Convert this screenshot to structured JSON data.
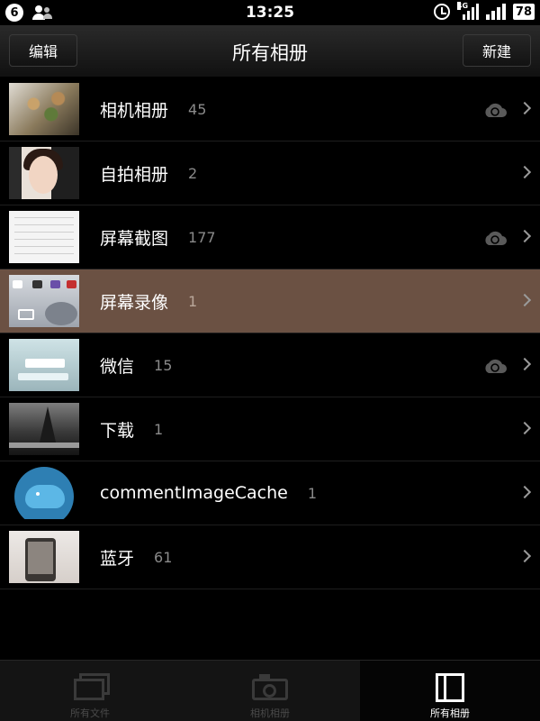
{
  "status_bar": {
    "notification_count": "6",
    "time": "13:25",
    "network_label": "4G",
    "battery": "78"
  },
  "nav": {
    "left_button": "编辑",
    "title": "所有相册",
    "right_button": "新建"
  },
  "albums": [
    {
      "name": "相机相册",
      "count": "45",
      "cloud": true,
      "thumb": "food-photo"
    },
    {
      "name": "自拍相册",
      "count": "2",
      "cloud": false,
      "thumb": "selfie-photo"
    },
    {
      "name": "屏幕截图",
      "count": "177",
      "cloud": true,
      "thumb": "screenshot"
    },
    {
      "name": "屏幕录像",
      "count": "1",
      "cloud": false,
      "selected": true,
      "thumb": "screen-recording"
    },
    {
      "name": "微信",
      "count": "15",
      "cloud": true,
      "thumb": "wechat-image"
    },
    {
      "name": "下载",
      "count": "1",
      "cloud": false,
      "thumb": "eiffel-tower-photo"
    },
    {
      "name": "commentImageCache",
      "count": "1",
      "cloud": false,
      "thumb": "whale-logo"
    },
    {
      "name": "蓝牙",
      "count": "61",
      "cloud": false,
      "thumb": "phone-photo"
    }
  ],
  "tabs": [
    {
      "label": "所有文件",
      "icon": "files-icon",
      "active": false
    },
    {
      "label": "相机相册",
      "icon": "camera-icon",
      "active": false
    },
    {
      "label": "所有相册",
      "icon": "album-icon",
      "active": true
    }
  ],
  "colors": {
    "background": "#000000",
    "selected_row": "#6b5143",
    "count_text": "#8a8a8a",
    "inactive_tab_text": "#4a4a4a"
  }
}
